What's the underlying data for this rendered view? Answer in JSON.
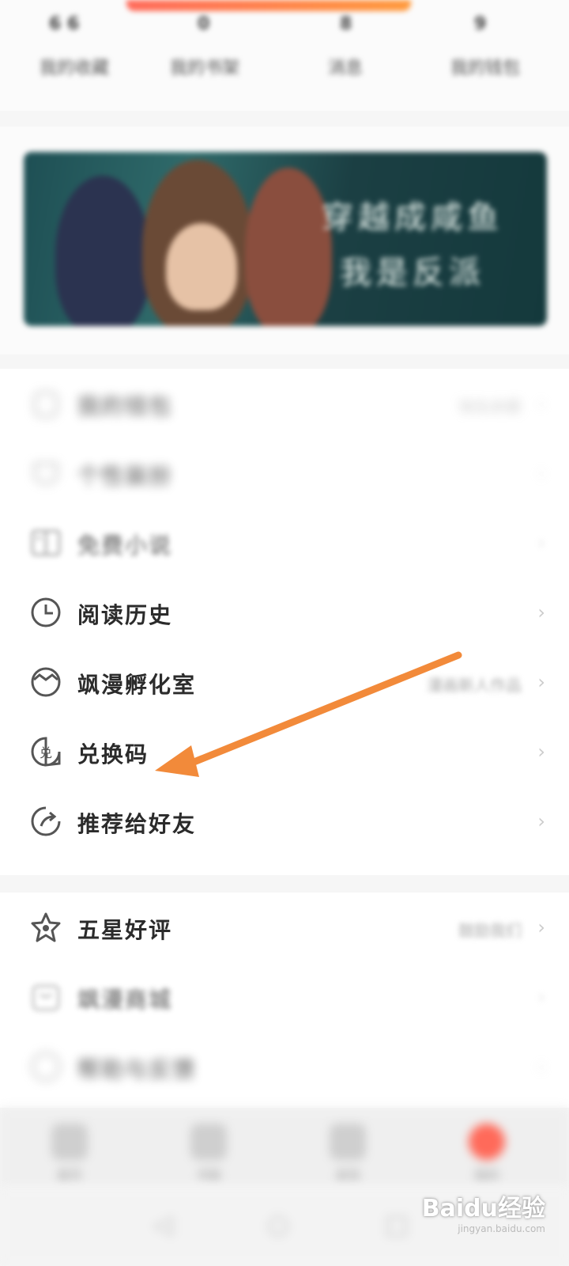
{
  "top": {
    "counts": [
      "6 6",
      "0",
      "8",
      "9"
    ],
    "shortcuts": [
      "我的收藏",
      "我的书架",
      "消息",
      "我的钱包"
    ]
  },
  "banner": {
    "title_line1": "穿越成咸鱼",
    "title_line2": "我是反派"
  },
  "menu": [
    {
      "label": "我的钱包",
      "right": "钱包余额"
    },
    {
      "label": "个性装扮",
      "right": ""
    },
    {
      "label": "免费小说",
      "right": ""
    },
    {
      "label": "阅读历史",
      "right": ""
    },
    {
      "label": "飒漫孵化室",
      "right": "漫画新人作品"
    },
    {
      "label": "兑换码",
      "right": ""
    },
    {
      "label": "推荐给好友",
      "right": ""
    }
  ],
  "menu2": [
    {
      "label": "五星好评",
      "right": "鼓励我们"
    },
    {
      "label": "飒漫商城",
      "right": ""
    },
    {
      "label": "帮助与反馈",
      "right": ""
    }
  ],
  "bottom_nav": [
    "首页",
    "书架",
    "发现",
    "我的"
  ],
  "watermark": {
    "brand": "Baidu经验",
    "url": "jingyan.baidu.com"
  },
  "colors": {
    "arrow": "#f28a3a",
    "accent": "#ff6a5a"
  }
}
